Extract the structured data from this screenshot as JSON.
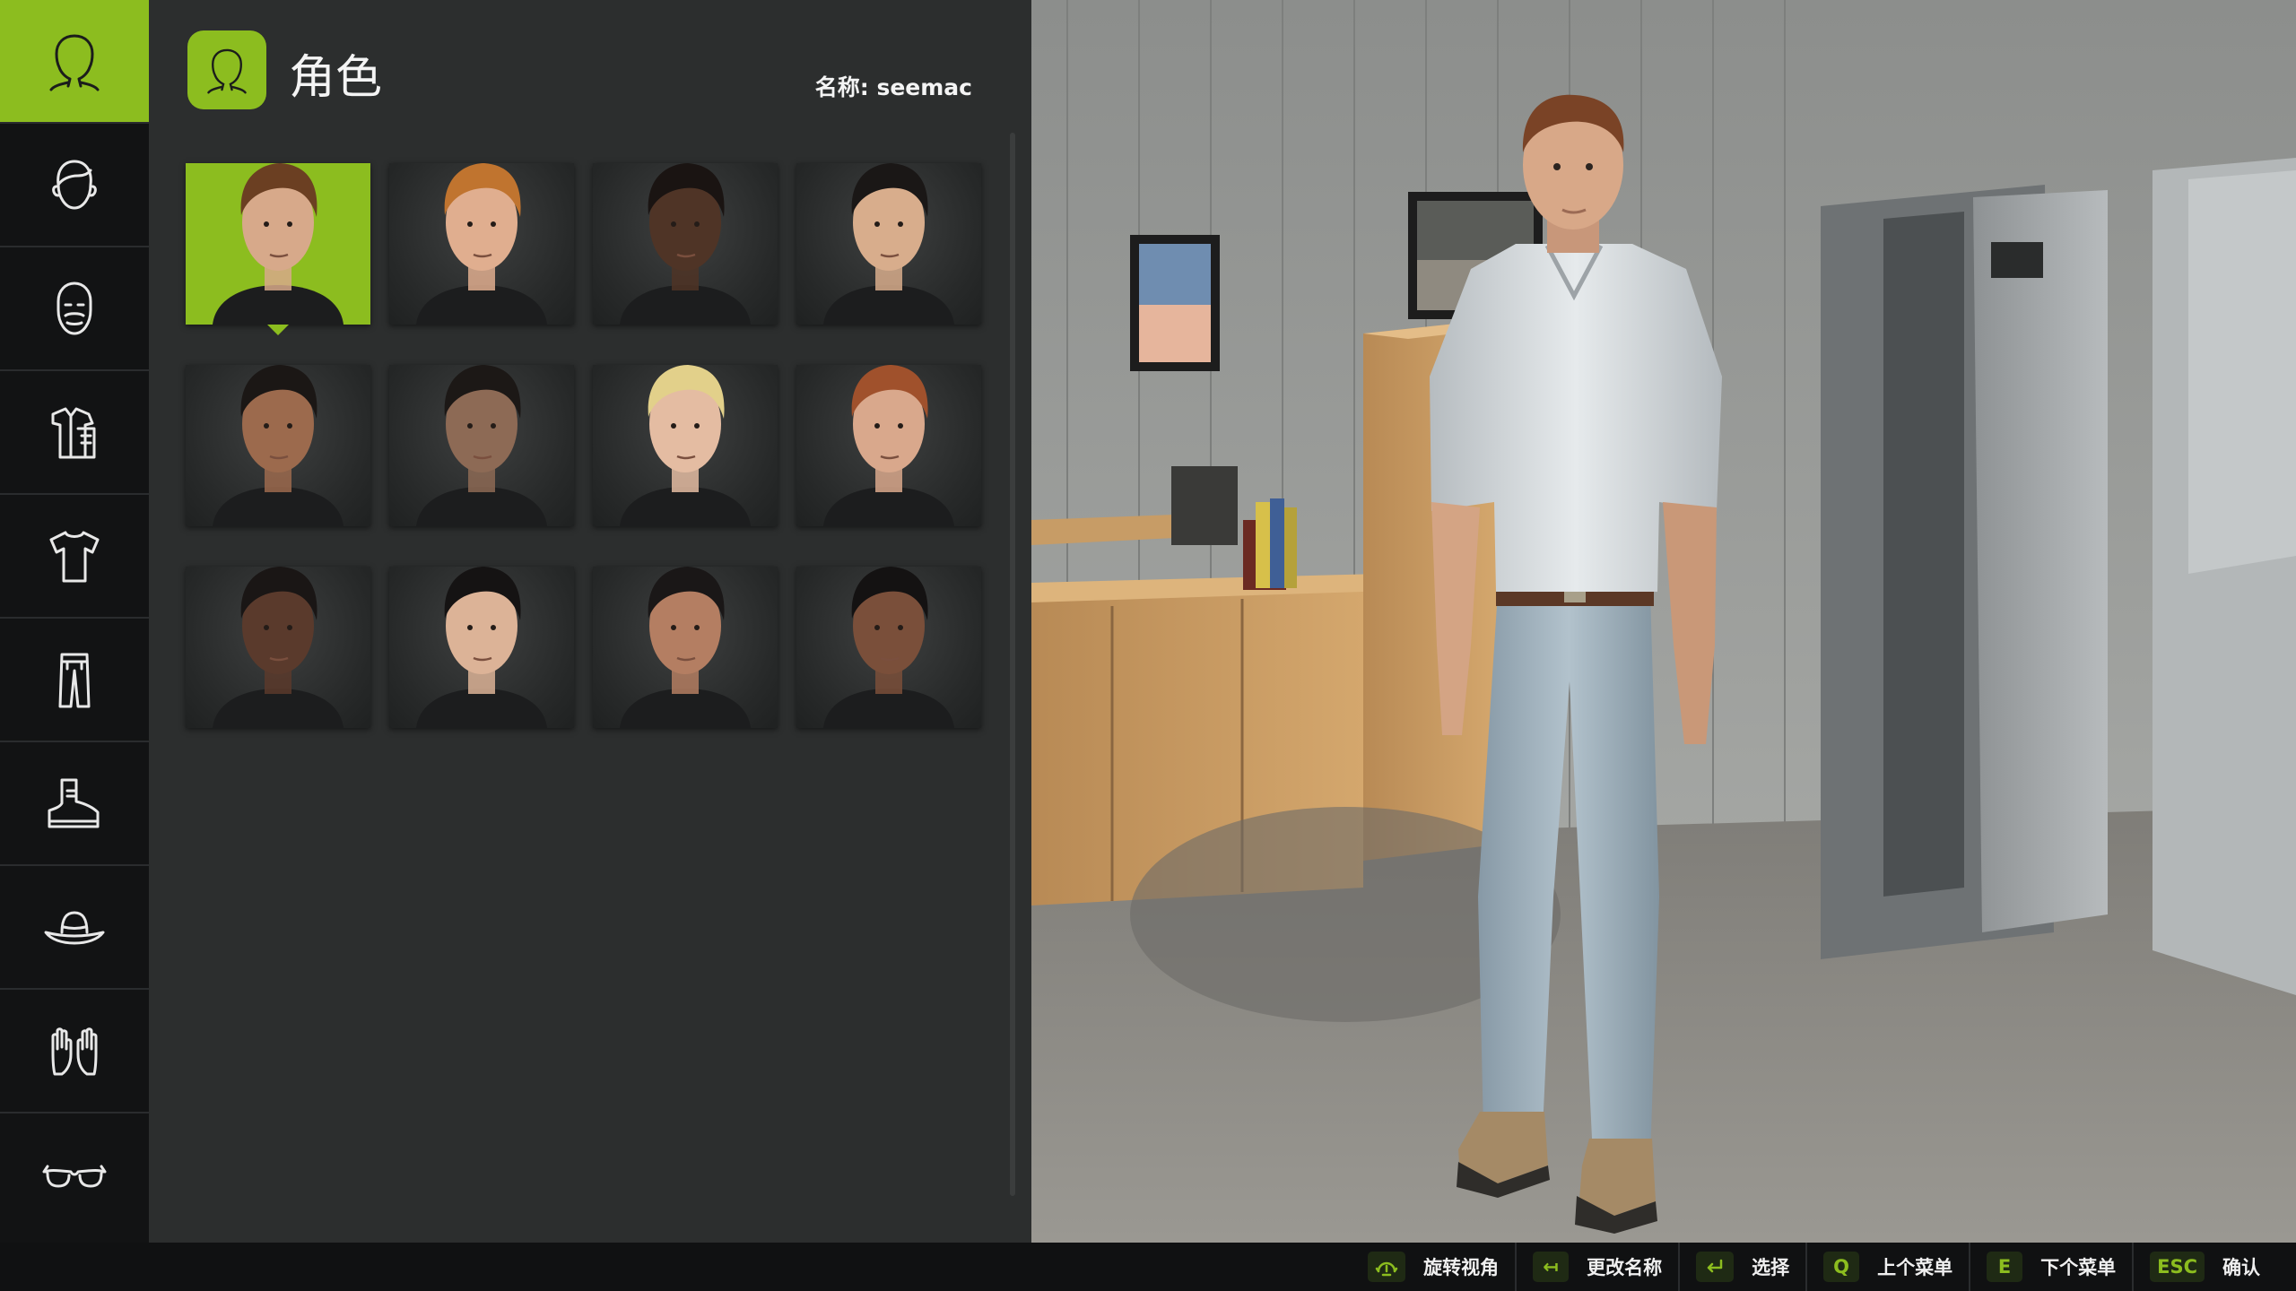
{
  "sidebar": {
    "items": [
      {
        "name": "character",
        "icon": "head-icon",
        "active": true
      },
      {
        "name": "hair",
        "icon": "hair-icon",
        "active": false
      },
      {
        "name": "beard",
        "icon": "beard-icon",
        "active": false
      },
      {
        "name": "outfit",
        "icon": "outfit-icon",
        "active": false
      },
      {
        "name": "shirt",
        "icon": "shirt-icon",
        "active": false
      },
      {
        "name": "pants",
        "icon": "pants-icon",
        "active": false
      },
      {
        "name": "boots",
        "icon": "boot-icon",
        "active": false
      },
      {
        "name": "hat",
        "icon": "hat-icon",
        "active": false
      },
      {
        "name": "gloves",
        "icon": "gloves-icon",
        "active": false
      },
      {
        "name": "glasses",
        "icon": "glasses-icon",
        "active": false
      }
    ]
  },
  "panel": {
    "title": "角色",
    "name_label": "名称: seemac"
  },
  "characters": [
    {
      "id": 1,
      "skin": "#d7a98a",
      "hair": "#6b3f22",
      "selected": true
    },
    {
      "id": 2,
      "skin": "#e0ae8f",
      "hair": "#c0742f",
      "selected": false
    },
    {
      "id": 3,
      "skin": "#4f3426",
      "hair": "#1a1412",
      "selected": false
    },
    {
      "id": 4,
      "skin": "#d8ad8c",
      "hair": "#1a1716",
      "selected": false
    },
    {
      "id": 5,
      "skin": "#9c6a4d",
      "hair": "#1b1715",
      "selected": false
    },
    {
      "id": 6,
      "skin": "#8d6a55",
      "hair": "#1c1816",
      "selected": false
    },
    {
      "id": 7,
      "skin": "#e4bca2",
      "hair": "#e2d08a",
      "selected": false
    },
    {
      "id": 8,
      "skin": "#d9a88c",
      "hair": "#a0512c",
      "selected": false
    },
    {
      "id": 9,
      "skin": "#5a3a2c",
      "hair": "#1a1615",
      "selected": false
    },
    {
      "id": 10,
      "skin": "#dcb397",
      "hair": "#151313",
      "selected": false
    },
    {
      "id": 11,
      "skin": "#b47e62",
      "hair": "#1a1717",
      "selected": false
    },
    {
      "id": 12,
      "skin": "#7a4f3a",
      "hair": "#141212",
      "selected": false
    }
  ],
  "hints": [
    {
      "key": "",
      "icon": "rotate-view-icon",
      "label": "旋转视角"
    },
    {
      "key": "↤",
      "icon": "backspace-icon",
      "label": "更改名称"
    },
    {
      "key": "",
      "icon": "enter-icon",
      "label": "选择"
    },
    {
      "key": "Q",
      "icon": "",
      "label": "上个菜单"
    },
    {
      "key": "E",
      "icon": "",
      "label": "下个菜单"
    },
    {
      "key": "ESC",
      "icon": "",
      "label": "确认"
    }
  ],
  "colors": {
    "accent": "#8cbd1f",
    "panel_bg": "#2c2e2e",
    "sidebar_bg": "#121314"
  }
}
